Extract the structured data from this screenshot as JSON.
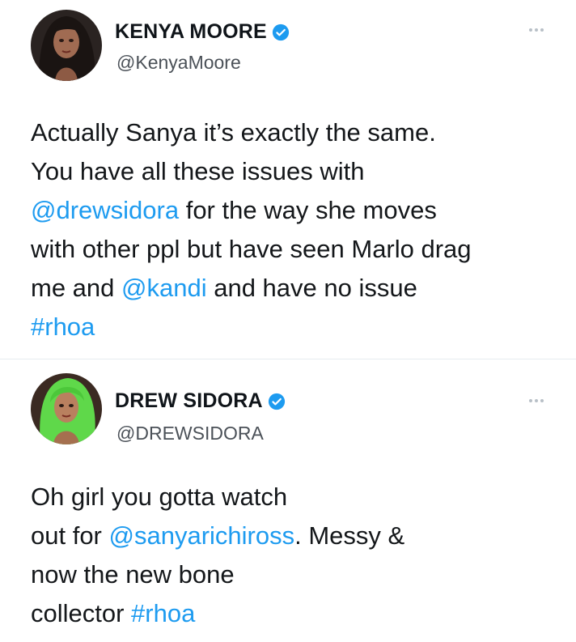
{
  "tweets": [
    {
      "name": "KENYA MOORE",
      "handle": "@KenyaMoore",
      "lines": [
        [
          {
            "t": "Actually Sanya it’s exactly the same."
          }
        ],
        [
          {
            "t": "You have all these issues with"
          }
        ],
        [
          {
            "t": "@drewsidora",
            "link": true
          },
          {
            "t": " for the way she moves"
          }
        ],
        [
          {
            "t": "with other ppl but have seen Marlo drag"
          }
        ],
        [
          {
            "t": "me and "
          },
          {
            "t": "@kandi",
            "link": true
          },
          {
            "t": " and have no issue"
          }
        ],
        [
          {
            "t": "#rhoa",
            "link": true
          }
        ]
      ]
    },
    {
      "name": "DREW SIDORA",
      "handle": "@DREWSIDORA",
      "lines": [
        [
          {
            "t": "Oh girl you gotta watch"
          }
        ],
        [
          {
            "t": "out for "
          },
          {
            "t": "@sanyarichiross",
            "link": true
          },
          {
            "t": ". Messy &"
          }
        ],
        [
          {
            "t": "now the new bone"
          }
        ],
        [
          {
            "t": "collector "
          },
          {
            "t": "#rhoa",
            "link": true
          }
        ]
      ]
    }
  ],
  "icons": {
    "verified": "verified-badge-icon",
    "more": "more-options-icon"
  },
  "colors": {
    "link": "#1d9bf0",
    "verified": "#1d9bf0",
    "text": "#14171a",
    "secondary": "#4b5158"
  }
}
